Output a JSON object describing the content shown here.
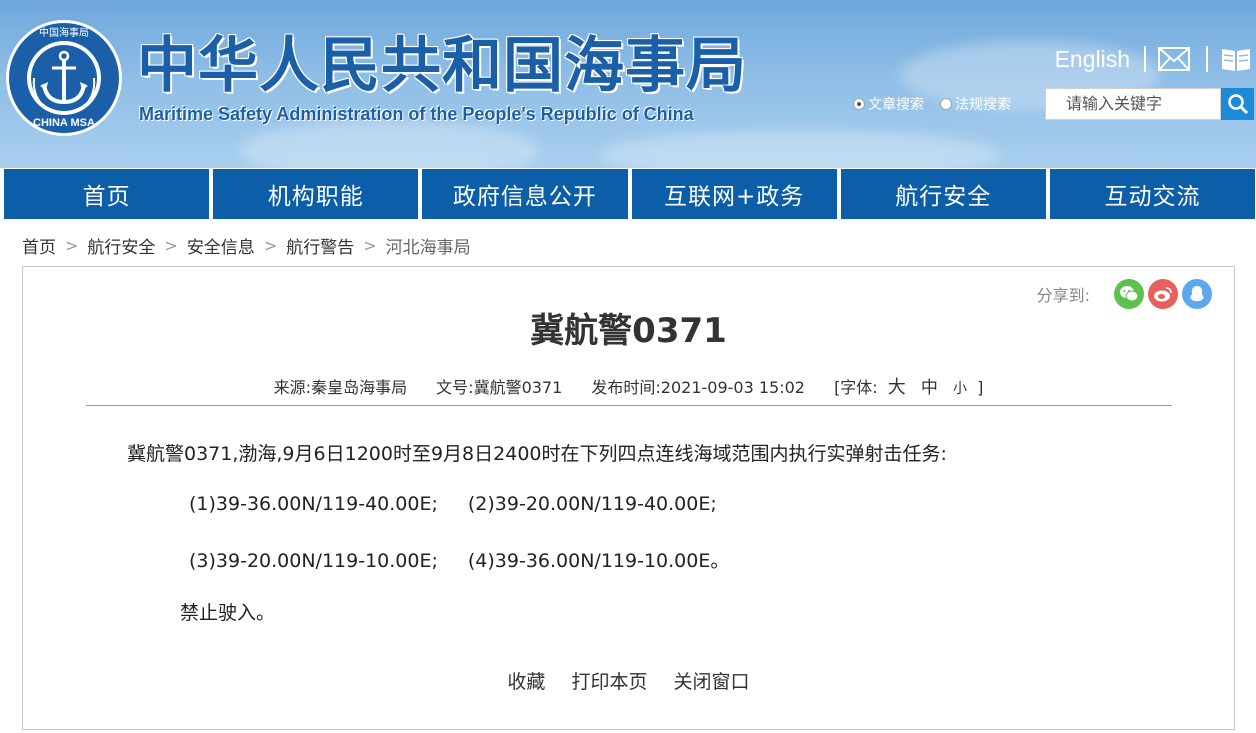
{
  "header": {
    "title_cn": "中华人民共和国海事局",
    "title_en": "Maritime Safety Administration of the People's Republic of China",
    "logo_text": "CHINA MSA",
    "logo_ring_text": "中国海事局",
    "english_link": "English",
    "search_options": [
      "文章搜索",
      "法规搜索"
    ],
    "search_selected": "文章搜索",
    "search_placeholder": "请输入关键字"
  },
  "nav": [
    "首页",
    "机构职能",
    "政府信息公开",
    "互联网+政务",
    "航行安全",
    "互动交流"
  ],
  "breadcrumb": [
    "首页",
    "航行安全",
    "安全信息",
    "航行警告",
    "河北海事局"
  ],
  "article": {
    "share_label": "分享到:",
    "title": "冀航警0371",
    "source": "来源:秦皇岛海事局",
    "doc_no": "文号:冀航警0371",
    "publish_time": "发布时间:2021-09-03 15:02",
    "font_label": "[字体:",
    "font_big": "大",
    "font_mid": "中",
    "font_small": "小",
    "font_close": "]",
    "paragraph": "冀航警0371,渤海,9月6日1200时至9月8日2400时在下列四点连线海域范围内执行实弹射击任务:",
    "points": [
      "(1)39-36.00N/119-40.00E;",
      "(2)39-20.00N/119-40.00E;",
      "(3)39-20.00N/119-10.00E;",
      "(4)39-36.00N/119-10.00E。"
    ],
    "closing": "禁止驶入。",
    "actions": [
      "收藏",
      "打印本页",
      "关闭窗口"
    ]
  },
  "colors": {
    "brand_blue": "#1b5fa8",
    "nav_blue": "#0d5ea8",
    "search_button": "#1d8bd8"
  }
}
